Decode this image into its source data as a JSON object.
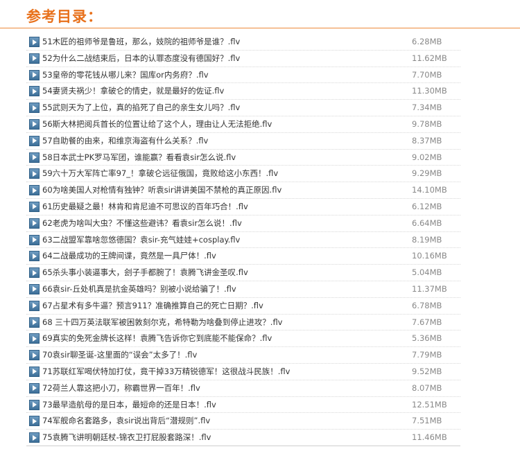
{
  "header": {
    "title": "参考目录："
  },
  "files": [
    {
      "name": "51木匠的祖师爷是鲁班，那么，妓院的祖师爷是谁？.flv",
      "size": "6.28MB"
    },
    {
      "name": "52为什么二战结束后，日本的认罪态度没有德国好？.flv",
      "size": "11.62MB"
    },
    {
      "name": "53皇帝的零花钱从哪儿来？国库or内务府？.flv",
      "size": "7.70MB"
    },
    {
      "name": "54妻贤夫祸少！拿破仑的情史，就是最好的佐证.flv",
      "size": "11.30MB"
    },
    {
      "name": "55武则天为了上位，真的掐死了自己的亲生女儿吗？.flv",
      "size": "7.34MB"
    },
    {
      "name": "56斯大林把阅兵首长的位置让给了这个人，理由让人无法拒绝.flv",
      "size": "9.78MB"
    },
    {
      "name": "57自助餐的由来，和维京海盗有什么关系？.flv",
      "size": "8.37MB"
    },
    {
      "name": "58日本武士PK罗马军团，谁能赢？看看袁sir怎么说.flv",
      "size": "9.02MB"
    },
    {
      "name": "59六十万大军阵亡率97_！拿破仑远征俄国，竟败给这小东西！.flv",
      "size": "9.29MB"
    },
    {
      "name": "60为啥美国人对枪情有独钟？听袁sir讲讲美国不禁枪的真正原因.flv",
      "size": "14.10MB"
    },
    {
      "name": "61历史最疑之最！林肯和肯尼迪不可思议的百年巧合！.flv",
      "size": "6.12MB"
    },
    {
      "name": "62老虎为啥叫大虫？不懂这些避讳？看袁sir怎么说！.flv",
      "size": "6.64MB"
    },
    {
      "name": "63二战盟军靠啥忽悠德国？袁sir-充气娃娃+cosplay.flv",
      "size": "8.19MB"
    },
    {
      "name": "64二战最成功的王牌间谍，竟然是一具尸体！.flv",
      "size": "10.16MB"
    },
    {
      "name": "65杀头事小装逼事大，刽子手都腕了！袁腾飞讲金圣叹.flv",
      "size": "5.04MB"
    },
    {
      "name": "66袁sir-丘处机真是抗金英雄吗？别被小说给骗了！.flv",
      "size": "11.37MB"
    },
    {
      "name": "67占星术有多牛逼？预言911？准确推算自己的死亡日期？.flv",
      "size": "6.78MB"
    },
    {
      "name": "68 三十四万英法联军被困敦刻尔克，希特勒为啥叠到停止进攻？.flv",
      "size": "7.67MB"
    },
    {
      "name": "69真实的免死金牌长这样！袁腾飞告诉你它到底能不能保命？.flv",
      "size": "5.36MB"
    },
    {
      "name": "70袁sir聊圣诞-这里面的“误会”太多了！.flv",
      "size": "7.79MB"
    },
    {
      "name": "71苏联红军喝伏特加打仗，竟干掉33万精锐德军！这很战斗民族！.flv",
      "size": "9.52MB"
    },
    {
      "name": "72荷兰人靠这把小刀，称霸世界一百年！.flv",
      "size": "8.07MB"
    },
    {
      "name": "73最早造航母的是日本，最短命的还是日本！.flv",
      "size": "12.51MB"
    },
    {
      "name": "74军舰命名套路多，袁sir说出背后“潜规则”.flv",
      "size": "7.51MB"
    },
    {
      "name": "75袁腾飞讲明朝廷杖-锦衣卫打屁股套路深！.flv",
      "size": "11.46MB"
    }
  ],
  "colors": {
    "title": "#e8711c",
    "header_rule": "#ee8a3a",
    "file_name": "#333333",
    "file_size": "#888888",
    "icon": "#3d6f98"
  },
  "icons": {
    "row_icon": "video-play-icon"
  }
}
